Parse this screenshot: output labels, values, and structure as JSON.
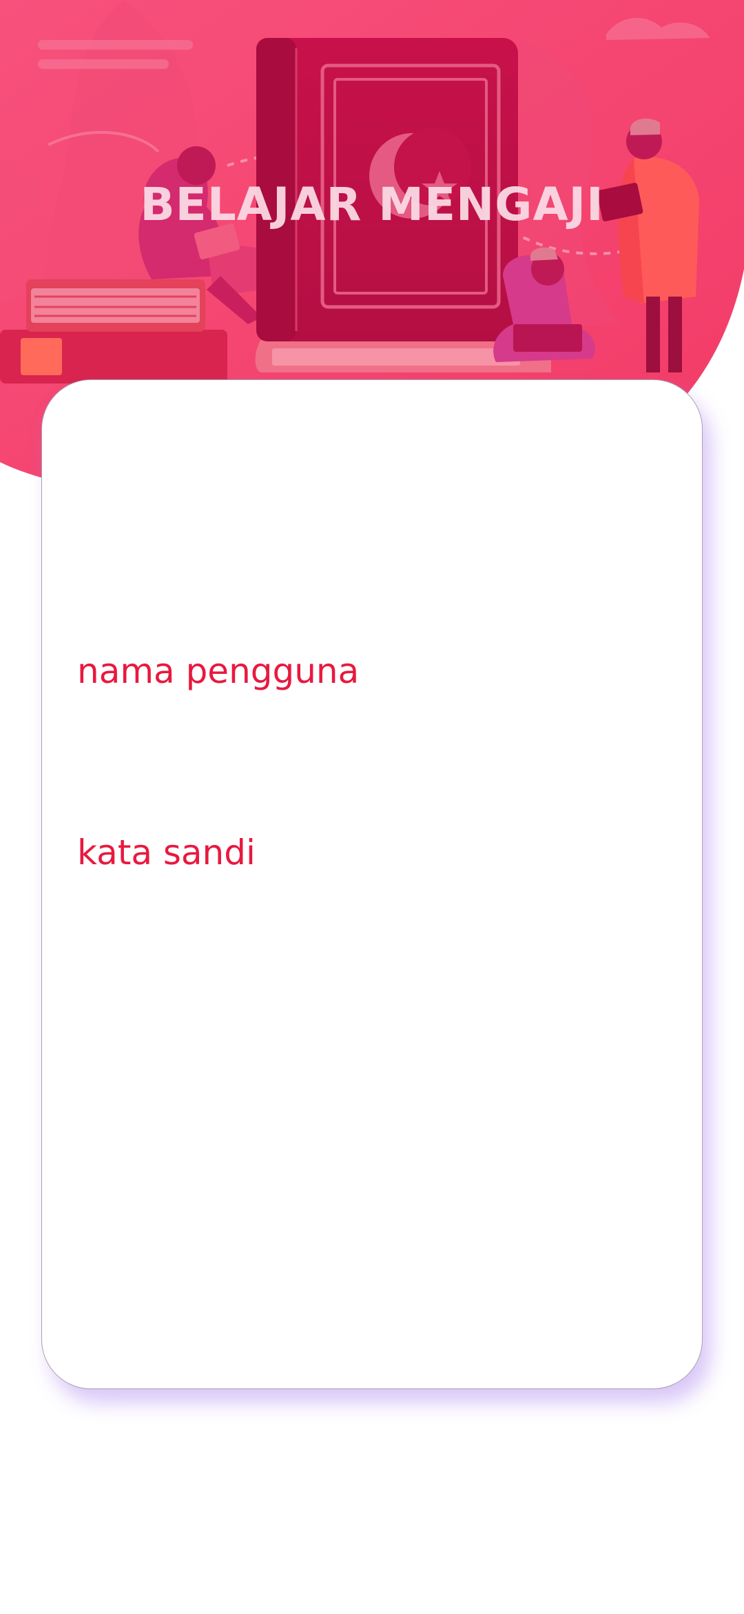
{
  "header": {
    "title": "BELAJAR MENGAJI"
  },
  "login_form": {
    "username_label": "nama pengguna",
    "username_value": "",
    "password_label": "kata sandi",
    "password_value": ""
  },
  "colors": {
    "hero_pink": "#f43f6f",
    "book_crimson": "#c4124a",
    "label_red": "#e8193f",
    "title_text": "#fbd9e4",
    "card_shadow": "#aa82f0"
  },
  "icons": {
    "hero": "quran-reading-illustration"
  }
}
